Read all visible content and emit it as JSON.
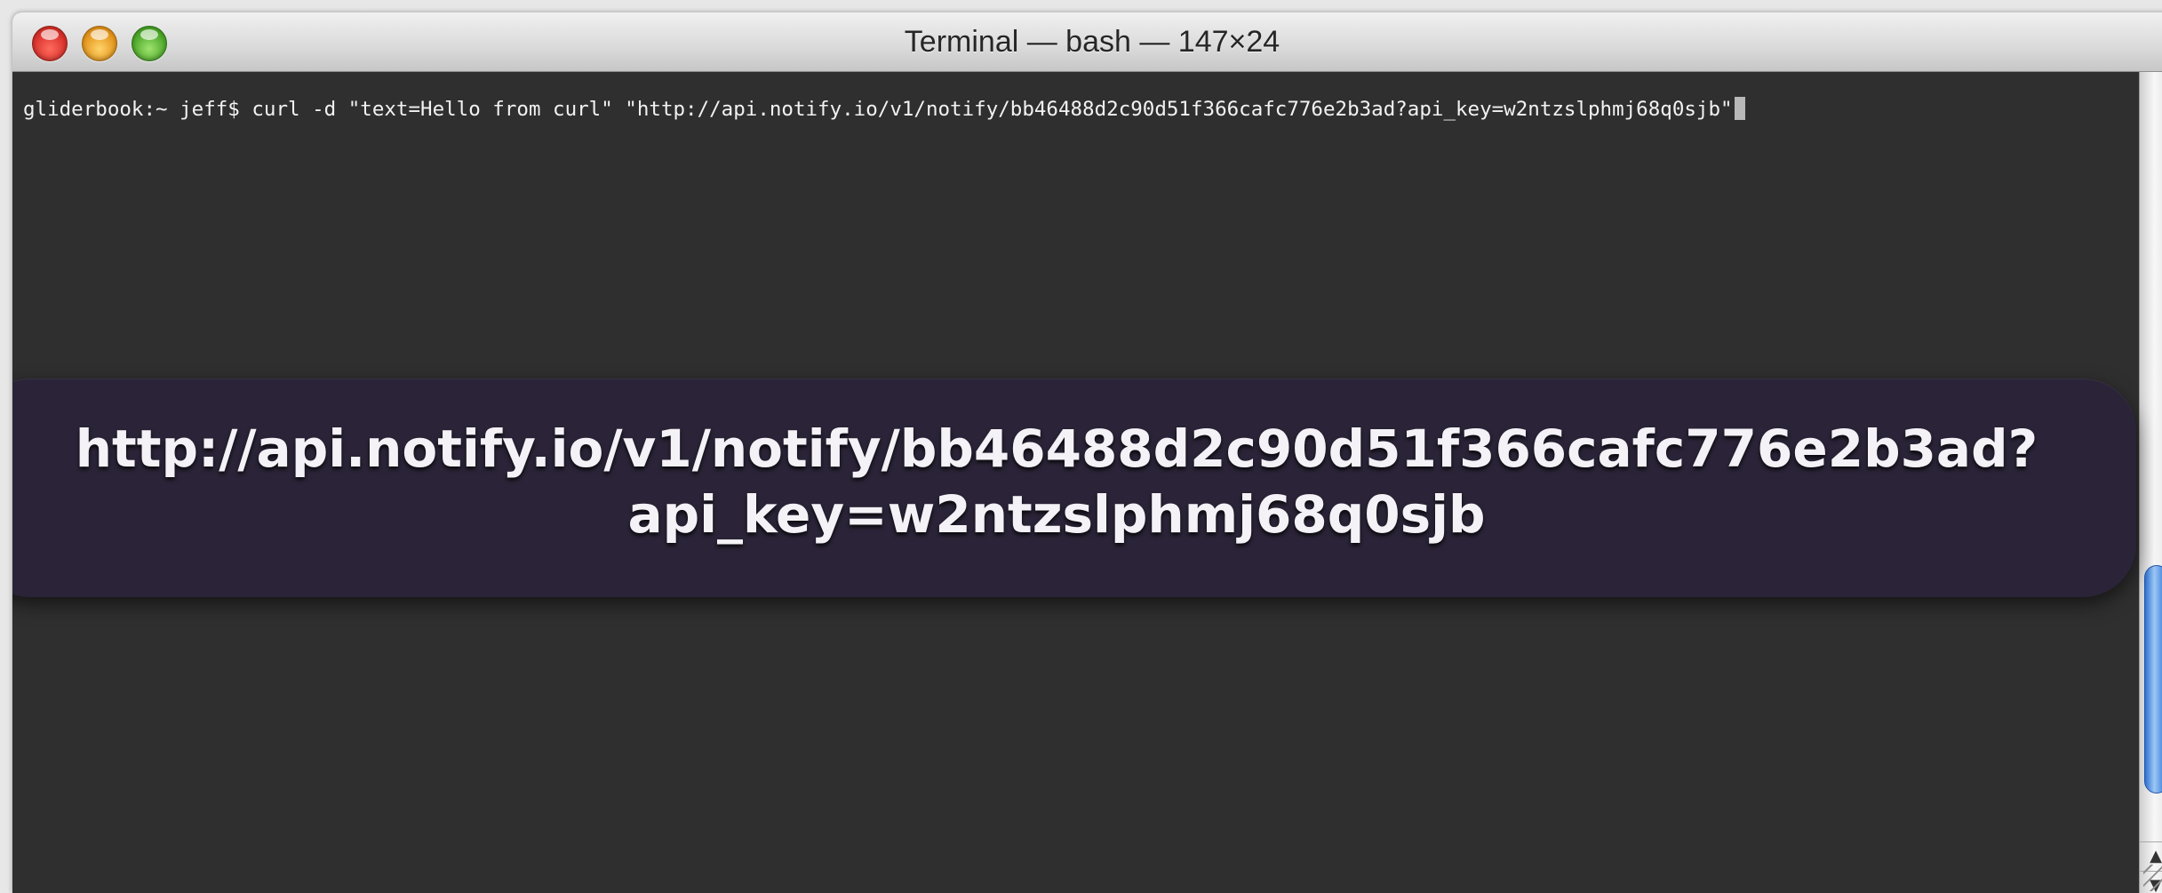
{
  "window": {
    "title": "Terminal — bash — 147×24"
  },
  "terminal": {
    "command_line": "gliderbook:~ jeff$ curl -d \"text=Hello from curl\" \"http://api.notify.io/v1/notify/bb46488d2c90d51f366cafc776e2b3ad?api_key=w2ntzslphmj68q0sjb\""
  },
  "overlay": {
    "line1": "http://api.notify.io/v1/notify/bb46488d2c90d51f366cafc776e2b3ad?",
    "line2": "api_key=w2ntzslphmj68q0sjb"
  },
  "scrollbar": {
    "up_arrow": "▲",
    "down_arrow": "▼"
  },
  "colors": {
    "terminal_bg": "#2f2f2f",
    "overlay_bg": "#2b2438",
    "scroll_thumb": "#5d98e4"
  }
}
